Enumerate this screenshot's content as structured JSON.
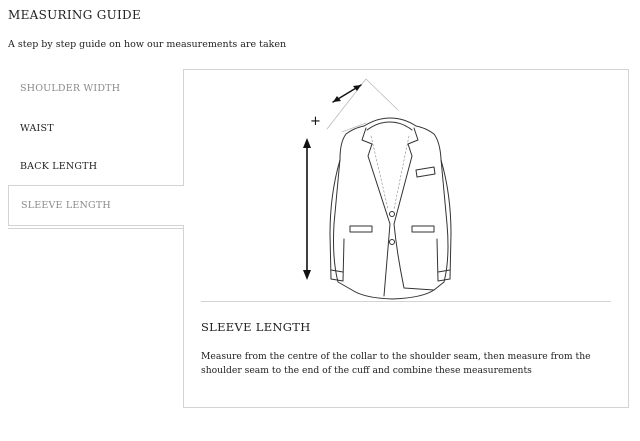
{
  "header": {
    "title": "MEASURING GUIDE",
    "subtitle": "A step by step guide on how our measurements are taken"
  },
  "tabs": [
    {
      "label": "SHOULDER WIDTH"
    },
    {
      "label": "WAIST"
    },
    {
      "label": "BACK LENGTH"
    },
    {
      "label": "SLEEVE LENGTH"
    }
  ],
  "active_tab": "SLEEVE LENGTH",
  "panel": {
    "illustration_icon": "jacket-sleeve-measure-icon",
    "plus_symbol": "+",
    "heading": "SLEEVE LENGTH",
    "description": "Measure from the centre of the collar to the shoulder seam, then measure from the shoulder seam to the end of the cuff and combine these measurements"
  },
  "colors": {
    "text": "#222222",
    "muted_text": "#8a8a8a",
    "border": "#d3d3d3",
    "background": "#ffffff"
  }
}
